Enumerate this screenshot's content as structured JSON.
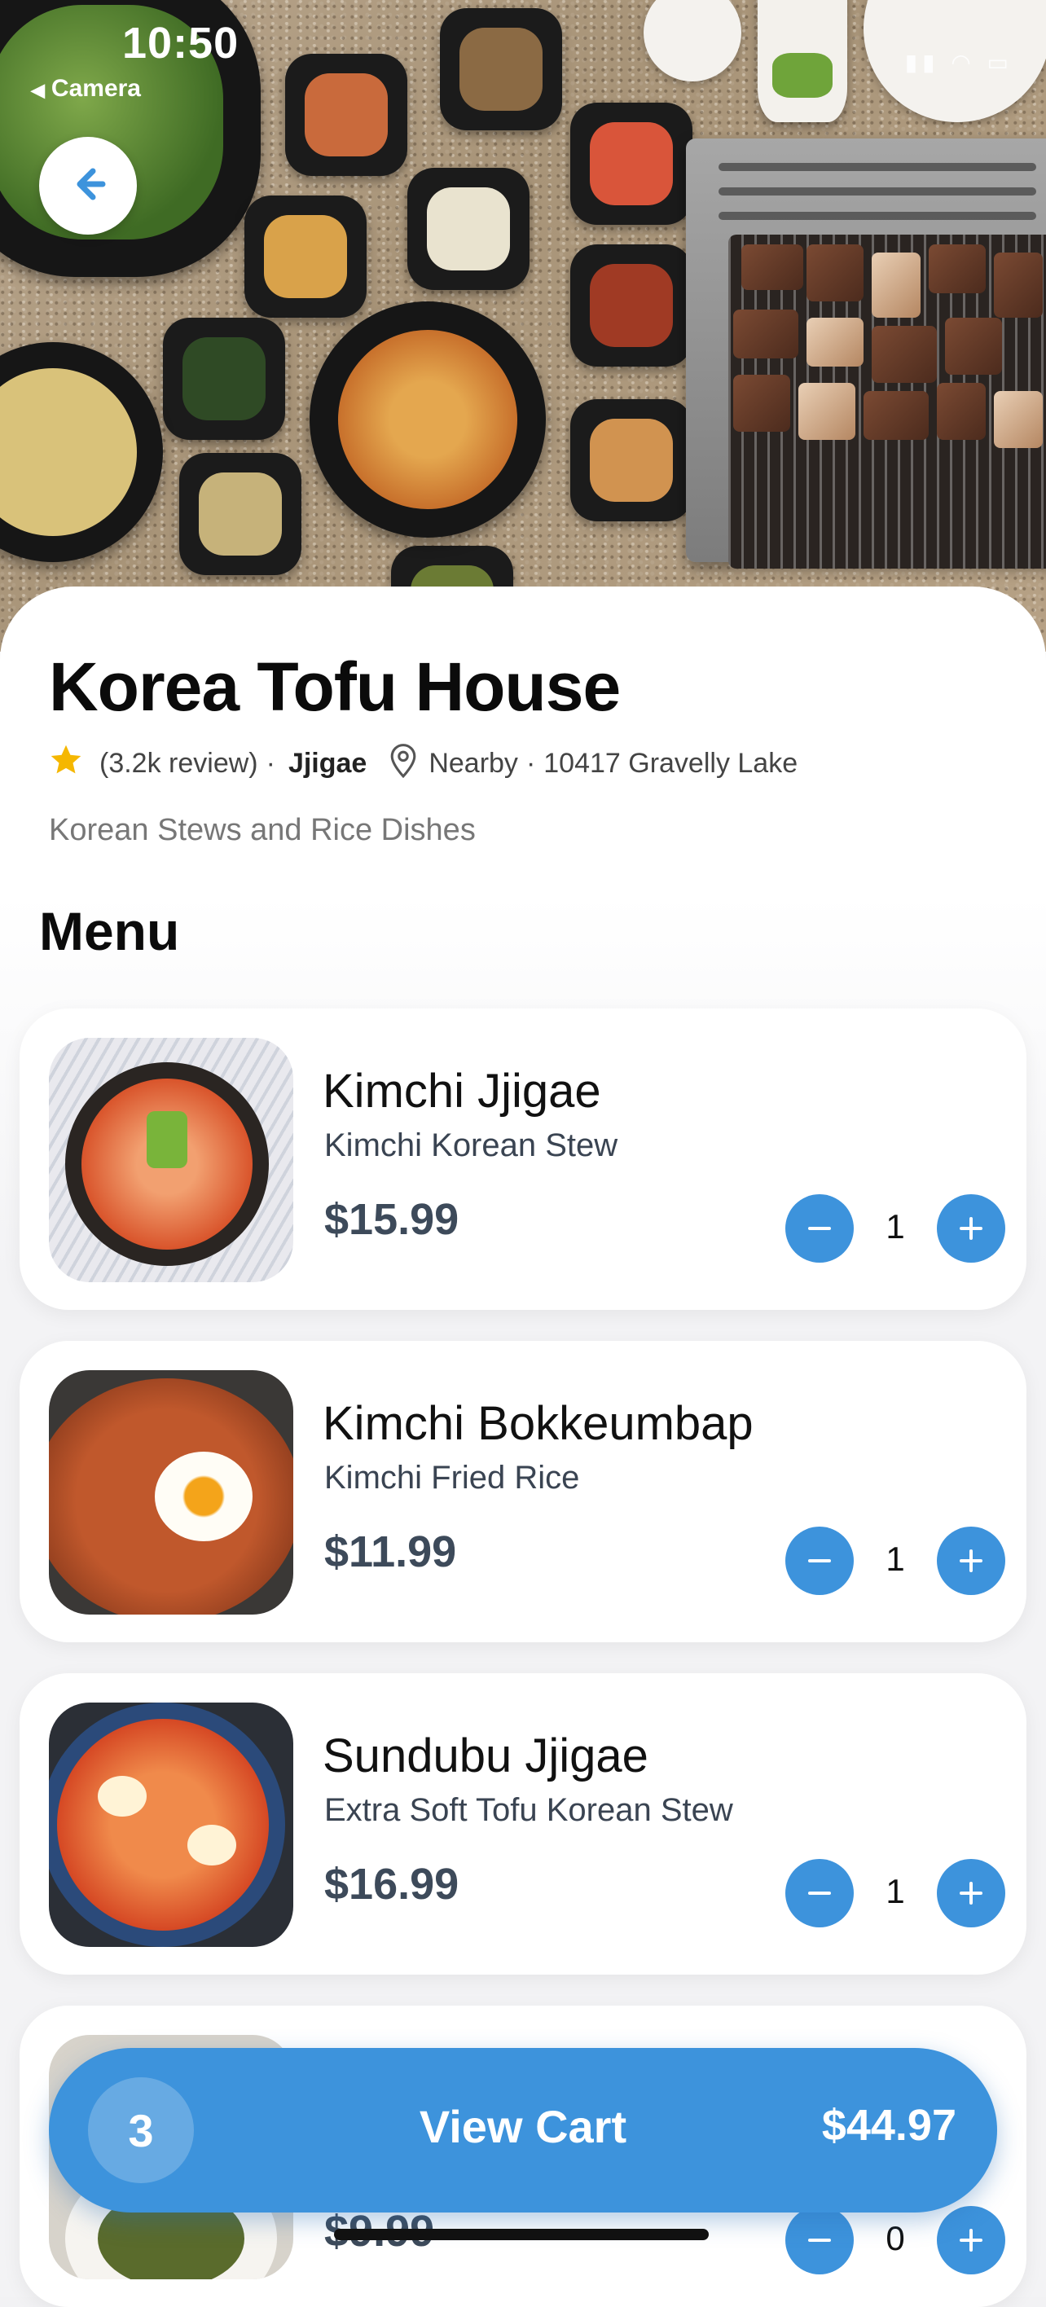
{
  "status_bar": {
    "time": "10:50",
    "back_app": "Camera"
  },
  "restaurant": {
    "name": "Korea Tofu House",
    "rating_text": "(3.2k review)",
    "separator": "·",
    "category": "Jjigae",
    "distance": "Nearby",
    "address": "10417 Gravelly Lake",
    "cuisine": "Korean Stews and Rice Dishes"
  },
  "menu": {
    "heading": "Menu",
    "items": [
      {
        "name": "Kimchi Jjigae",
        "subtitle": "Kimchi Korean Stew",
        "price": "$15.99",
        "qty": "1"
      },
      {
        "name": "Kimchi Bokkeumbap",
        "subtitle": "Kimchi Fried Rice",
        "price": "$11.99",
        "qty": "1"
      },
      {
        "name": "Sundubu Jjigae",
        "subtitle": "Extra Soft Tofu Korean Stew",
        "price": "$16.99",
        "qty": "1"
      },
      {
        "name": "",
        "subtitle": "",
        "price": "$9.99",
        "qty": "0"
      }
    ]
  },
  "cart": {
    "count": "3",
    "label": "View Cart",
    "total": "$44.97"
  },
  "colors": {
    "accent": "#3d93dc",
    "star": "#f5b700"
  },
  "icons": [
    "back-arrow-icon",
    "star-icon",
    "location-pin-icon",
    "minus-icon",
    "plus-icon"
  ]
}
